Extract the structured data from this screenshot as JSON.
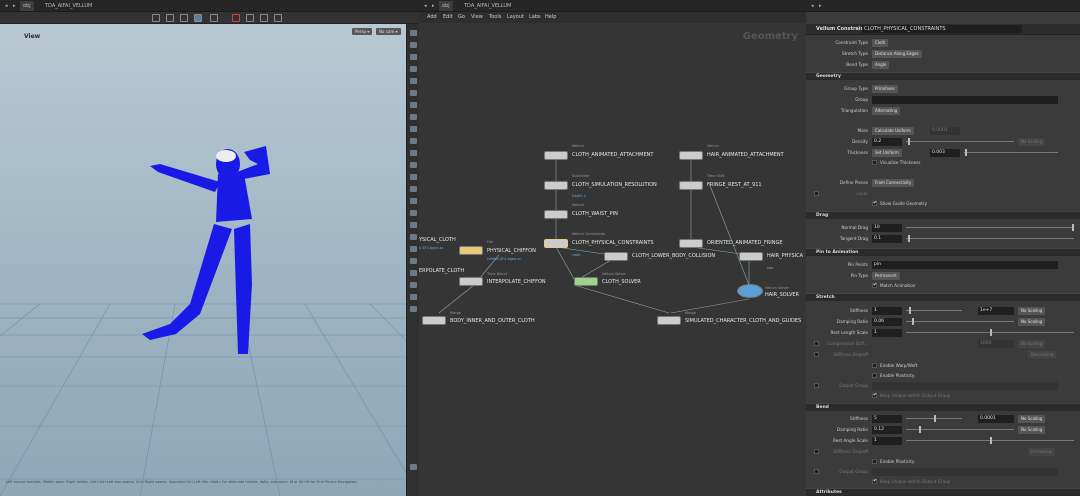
{
  "viewport": {
    "tab": "obj",
    "title": "TDA_AIFAI_VELLUM",
    "label": "View",
    "persp": "Persp ▾",
    "cam": "No cam ▾",
    "status": "Left mouse tumbles. Middle pans. Right dollies. Ctrl+Alt+Left box-zooms. Ctrl+Right zooms. Spacebar-Ctrl-Left tilts. Hold L for alternate tumble, dolly, and zoom. M or Alt+M for First Person Navigation."
  },
  "network": {
    "tab": "obj",
    "title": "TDA_AIFAI_VELLUM",
    "context": "Geometry",
    "menus": [
      "Add",
      "Edit",
      "Go",
      "View",
      "Tools",
      "Layout",
      "Labs",
      "Help"
    ],
    "nodes": [
      {
        "name": "CLOTH_ANIMATED_ATTACHMENT",
        "type": "Vellum",
        "sub": ""
      },
      {
        "name": "HAIR_ANIMATED_ATTACHMENT",
        "type": "Vellum",
        "sub": ""
      },
      {
        "name": "CLOTH_SIMULATION_RESOLUTION",
        "type": "Subdivide",
        "sub": "Depth 1"
      },
      {
        "name": "FRINGE_REST_AT_911",
        "type": "Time Shift",
        "sub": ""
      },
      {
        "name": "CLOTH_WAIST_PIN",
        "type": "Vellum",
        "sub": ""
      },
      {
        "name": "CLOTH_PHYSICAL_CONSTRAINTS",
        "type": "Vellum Constraints",
        "sub": "cloth"
      },
      {
        "name": "CLOTH_LOWER_BODY_COLLISION",
        "type": "Vellum",
        "sub": ""
      },
      {
        "name": "ORIENTED_ANIMATED_FRINGE",
        "type": "Vellum",
        "sub": ""
      },
      {
        "name": "HAIR_PHYSICA",
        "type": "Vellum Constraints",
        "sub": "hair"
      },
      {
        "name": "PHYSICAL_CHIFFON",
        "type": "File",
        "sub": "chiffon.$F4.bgeo.sc"
      },
      {
        "name": "YSICAL_CLOTH",
        "type": "",
        "sub": "h.$F4.bgeo.sc"
      },
      {
        "name": "ERPOLATE_CLOTH",
        "type": "",
        "sub": ""
      },
      {
        "name": "INTERPOLATE_CHIFFON",
        "type": "Time Blend",
        "sub": ""
      },
      {
        "name": "CLOTH_SOLVER",
        "type": "Vellum Solver",
        "sub": ""
      },
      {
        "name": "HAIR_SOLVER",
        "type": "Vellum Solver",
        "sub": ""
      },
      {
        "name": "BODY_INNER_AND_OUTER_CLOTH",
        "type": "Merge",
        "sub": ""
      },
      {
        "name": "SIMULATED_CHARACTER_CLOTH_AND_GUIDES",
        "type": "Merge",
        "sub": ""
      }
    ]
  },
  "params": {
    "node_type": "Vellum Constraints",
    "node_name": "CLOTH_PHYSICAL_CONSTRAINTS",
    "constraint_type": {
      "label": "Constraint Type",
      "value": "Cloth"
    },
    "stretch_type": {
      "label": "Stretch Type",
      "value": "Distance Along Edges"
    },
    "bend_type": {
      "label": "Bend Type",
      "value": "Angle"
    },
    "sect_geometry": "Geometry",
    "group_type": {
      "label": "Group Type",
      "value": "Primitives"
    },
    "group": {
      "label": "Group",
      "value": ""
    },
    "triangulation": {
      "label": "Triangulation",
      "value": "Alternating"
    },
    "mass": {
      "label": "Mass",
      "value": "Calculate Uniform",
      "num": "0.0001"
    },
    "density": {
      "label": "Density",
      "value": "0.2",
      "scale": "No Scaling"
    },
    "thickness": {
      "label": "Thickness",
      "value": "Set Uniform",
      "num": "0.003"
    },
    "visualize": "Visualize Thickness",
    "define_pieces": {
      "label": "Define Pieces",
      "value": "From Connectivity"
    },
    "layer": "Layer",
    "show_guide": "Show Guide Geometry",
    "sect_drag": "Drag",
    "normal_drag": {
      "label": "Normal Drag",
      "value": "10"
    },
    "tangent_drag": {
      "label": "Tangent Drag",
      "value": "0.1"
    },
    "sect_pin": "Pin to Animation",
    "pin_points": {
      "label": "Pin Points",
      "value": "pin"
    },
    "pin_type": {
      "label": "Pin Type",
      "value": "Permanent"
    },
    "match_anim": "Match Animation",
    "sect_stretch": "Stretch",
    "s_stiff": {
      "label": "Stiffness",
      "value": "1",
      "mult": "1e+7",
      "scale": "No Scaling"
    },
    "s_damp": {
      "label": "Damping Ratio",
      "value": "0.06",
      "scale": "No Scaling"
    },
    "s_rest": {
      "label": "Rest Length Scale",
      "value": "1"
    },
    "s_comp": {
      "label": "Compression Stiff...",
      "value": "",
      "mult": "1000"
    },
    "s_drop": {
      "label": "Stiffness Dropoff",
      "value": "",
      "mode": "Decreasing"
    },
    "warp": "Enable Warp/Weft",
    "plast1": "Enable Plasticity",
    "s_out": {
      "label": "Output Group",
      "value": ""
    },
    "keep1": "Keep Unique within Output Group",
    "sect_bend": "Bend",
    "b_stiff": {
      "label": "Stiffness",
      "value": "5",
      "mult": "0.0001",
      "scale": "No Scaling"
    },
    "b_damp": {
      "label": "Damping Ratio",
      "value": "0.12",
      "scale": "No Scaling"
    },
    "b_rest": {
      "label": "Rest Angle Scale",
      "value": "1"
    },
    "b_drop": {
      "label": "Stiffness Dropoff",
      "value": "",
      "mode": "Increasing"
    },
    "plast2": "Enable Plasticity",
    "b_out": {
      "label": "Output Group",
      "value": ""
    },
    "keep2": "Keep Unique within Output Group",
    "sect_attr": "Attributes"
  },
  "colors": {
    "node_sel": "#e8c87a",
    "solver": "#9fd28a",
    "hair_solver": "#5a9fd6",
    "figure": "#1a1ae6"
  }
}
